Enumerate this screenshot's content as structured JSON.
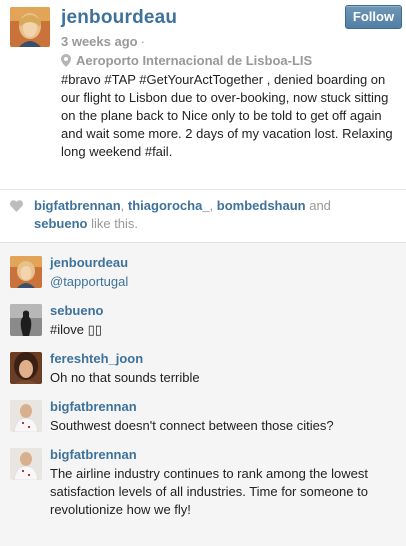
{
  "post": {
    "username": "jenbourdeau",
    "follow_label": "Follow",
    "time": "3 weeks ago",
    "time_sep": "·",
    "location": "Aeroporto Internacional de Lisboa-LIS",
    "caption": "#bravo #TAP #GetYourActTogether , denied boarding on our flight to Lisbon due to over-booking, now stuck sitting on the plane back to Nice only to be told to get off again and wait some more. 2 days of my vacation lost. Relaxing long weekend #fail."
  },
  "likes": {
    "users": [
      "bigfatbrennan",
      "thiagorocha_",
      "bombedshaun",
      "sebueno"
    ],
    "sep1": ", ",
    "sep2": ", ",
    "and_text": " and ",
    "suffix": " like this."
  },
  "comments": [
    {
      "username": "jenbourdeau",
      "text": "@tapportugal",
      "avatar": "woman-blonde"
    },
    {
      "username": "sebueno",
      "text": "#ilove ▯▯",
      "avatar": "silhouette"
    },
    {
      "username": "fereshteh_joon",
      "text": "Oh no that sounds terrible",
      "avatar": "woman-dark"
    },
    {
      "username": "bigfatbrennan",
      "text": "Southwest doesn't connect between those cities?",
      "avatar": "man-shirt"
    },
    {
      "username": "bigfatbrennan",
      "text": "The airline industry continues to rank among the lowest satisfaction levels of all industries. Time for someone to revolutionize how we fly!",
      "avatar": "man-shirt"
    }
  ],
  "colors": {
    "link": "#3f729b",
    "muted": "#999999",
    "follow_button": "#517fa4",
    "comments_bg": "#f5f5f5"
  }
}
